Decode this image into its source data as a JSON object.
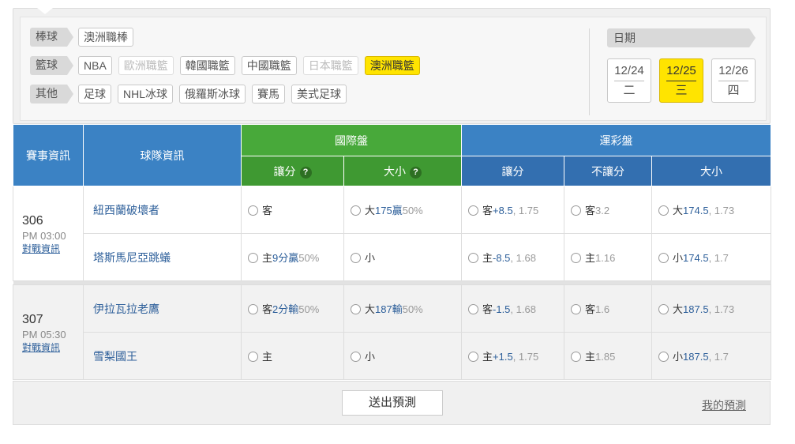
{
  "filters": {
    "rows": [
      {
        "category": "棒球",
        "items": [
          {
            "label": "澳洲職棒",
            "state": "normal"
          }
        ]
      },
      {
        "category": "籃球",
        "items": [
          {
            "label": "NBA",
            "state": "normal"
          },
          {
            "label": "歐洲職籃",
            "state": "disabled"
          },
          {
            "label": "韓國職籃",
            "state": "normal"
          },
          {
            "label": "中國職籃",
            "state": "normal"
          },
          {
            "label": "日本職籃",
            "state": "disabled"
          },
          {
            "label": "澳洲職籃",
            "state": "selected"
          }
        ]
      },
      {
        "category": "其他",
        "items": [
          {
            "label": "足球",
            "state": "normal"
          },
          {
            "label": "NHL冰球",
            "state": "normal"
          },
          {
            "label": "俄羅斯冰球",
            "state": "normal"
          },
          {
            "label": "賽馬",
            "state": "normal"
          },
          {
            "label": "美式足球",
            "state": "normal"
          }
        ]
      }
    ],
    "date_label": "日期",
    "dates": [
      {
        "date": "12/24",
        "weekday": "二",
        "selected": false
      },
      {
        "date": "12/25",
        "weekday": "三",
        "selected": true
      },
      {
        "date": "12/26",
        "weekday": "四",
        "selected": false
      }
    ]
  },
  "table": {
    "headers": {
      "event_info": "賽事資訊",
      "team_info": "球隊資訊",
      "intl": "國際盤",
      "lottery": "運彩盤",
      "intl_handicap": "讓分",
      "intl_total": "大小",
      "lot_handicap": "讓分",
      "lot_nohandicap": "不讓分",
      "lot_total": "大小",
      "help": "?"
    },
    "games": [
      {
        "num": "306",
        "time": "PM 03:00",
        "link": "對戰資訊",
        "rows": [
          {
            "team": "紐西蘭破壞者",
            "intl_handicap": {
              "lbl": "客",
              "val": "",
              "odds": ""
            },
            "intl_total": {
              "lbl": "大",
              "val": "175贏",
              "odds": "50%"
            },
            "lot_handicap": {
              "lbl": "客",
              "val": "+8.5",
              "odds": ", 1.75"
            },
            "lot_nohandicap": {
              "lbl": "客",
              "val": "",
              "odds": "3.2"
            },
            "lot_total": {
              "lbl": "大",
              "val": "174.5",
              "odds": ", 1.73"
            }
          },
          {
            "team": "塔斯馬尼亞跳蟻",
            "intl_handicap": {
              "lbl": "主",
              "val": "9分贏",
              "odds": "50%"
            },
            "intl_total": {
              "lbl": "小",
              "val": "",
              "odds": ""
            },
            "lot_handicap": {
              "lbl": "主",
              "val": "-8.5",
              "odds": ", 1.68"
            },
            "lot_nohandicap": {
              "lbl": "主",
              "val": "",
              "odds": "1.16"
            },
            "lot_total": {
              "lbl": "小",
              "val": "174.5",
              "odds": ", 1.7"
            }
          }
        ]
      },
      {
        "num": "307",
        "time": "PM 05:30",
        "link": "對戰資訊",
        "rows": [
          {
            "team": "伊拉瓦拉老鷹",
            "intl_handicap": {
              "lbl": "客",
              "val": "2分輸",
              "odds": "50%"
            },
            "intl_total": {
              "lbl": "大",
              "val": "187輸",
              "odds": "50%"
            },
            "lot_handicap": {
              "lbl": "客",
              "val": "-1.5",
              "odds": ", 1.68"
            },
            "lot_nohandicap": {
              "lbl": "客",
              "val": "",
              "odds": "1.6"
            },
            "lot_total": {
              "lbl": "大",
              "val": "187.5",
              "odds": ", 1.73"
            }
          },
          {
            "team": "雪梨國王",
            "intl_handicap": {
              "lbl": "主",
              "val": "",
              "odds": ""
            },
            "intl_total": {
              "lbl": "小",
              "val": "",
              "odds": ""
            },
            "lot_handicap": {
              "lbl": "主",
              "val": "+1.5",
              "odds": ", 1.75"
            },
            "lot_nohandicap": {
              "lbl": "主",
              "val": "",
              "odds": "1.85"
            },
            "lot_total": {
              "lbl": "小",
              "val": "187.5",
              "odds": ", 1.7"
            }
          }
        ]
      }
    ]
  },
  "footer": {
    "submit": "送出預測",
    "mine": "我的預測"
  }
}
